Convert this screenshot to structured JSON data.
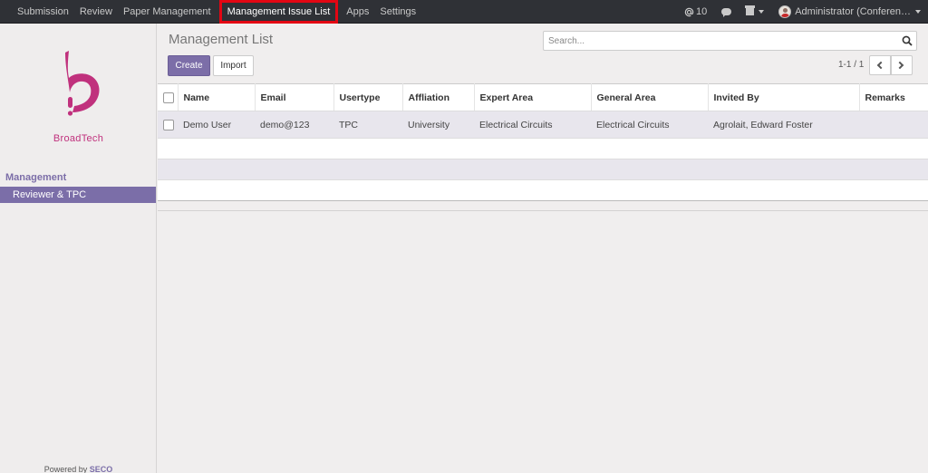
{
  "topnav": {
    "items": [
      "Submission",
      "Review",
      "Paper Management",
      "Management Issue List",
      "Apps",
      "Settings"
    ],
    "mention_count": "10",
    "user_label": "Administrator (Conferen…"
  },
  "sidebar": {
    "brand_name": "BroadTech",
    "section_label": "Management",
    "items": [
      {
        "label": "Reviewer & TPC",
        "active": true
      }
    ],
    "powered_by_prefix": "Powered by",
    "powered_by_brand": "SECO"
  },
  "main": {
    "title": "Management List",
    "search_placeholder": "Search...",
    "create_label": "Create",
    "import_label": "Import",
    "pager_text": "1-1 / 1"
  },
  "table": {
    "columns": [
      "Name",
      "Email",
      "Usertype",
      "Affliation",
      "Expert Area",
      "General Area",
      "Invited By",
      "Remarks"
    ],
    "rows": [
      [
        "Demo User",
        "demo@123",
        "TPC",
        "University",
        "Electrical Circuits",
        "Electrical Circuits",
        "Agrolait, Edward Foster",
        ""
      ]
    ]
  },
  "colors": {
    "topbar_bg": "#2f3136",
    "accent": "#7c6ea8",
    "highlight_outline": "#e30613",
    "brand_magenta": "#c0317d"
  },
  "icons": {
    "mention": "at-icon",
    "chat": "chat-bubble-icon",
    "gift": "gift-icon",
    "search": "search-icon",
    "prev": "chevron-left-icon",
    "next": "chevron-right-icon"
  }
}
